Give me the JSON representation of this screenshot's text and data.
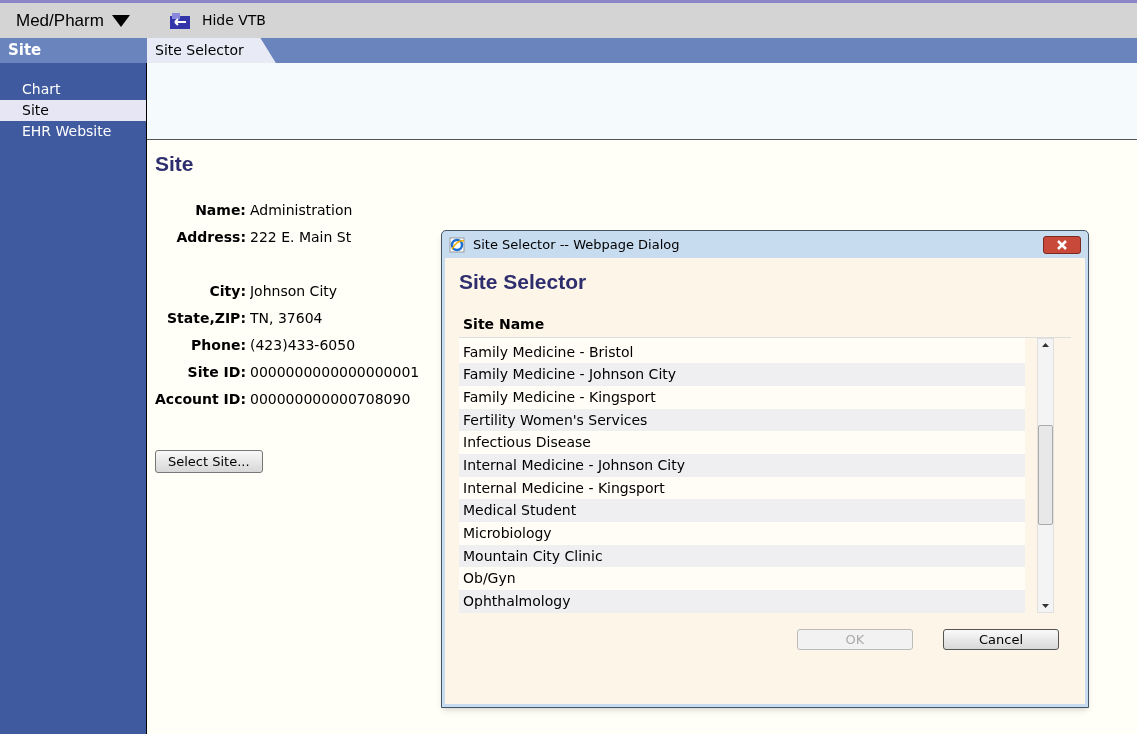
{
  "toolbar": {
    "menu": "Med/Pharm",
    "hide_button": "Hide VTB"
  },
  "sidebar": {
    "title": "Site",
    "items": [
      {
        "label": "Chart",
        "selected": false
      },
      {
        "label": "Site",
        "selected": true
      },
      {
        "label": "EHR Website",
        "selected": false
      }
    ]
  },
  "tabs": [
    {
      "label": "Site Selector",
      "selected": true
    }
  ],
  "site": {
    "heading": "Site",
    "field_groups": [
      [
        {
          "label": "Name:",
          "value": "Administration"
        },
        {
          "label": "Address:",
          "value": "222 E. Main St"
        }
      ],
      [
        {
          "label": "City:",
          "value": "Johnson City"
        },
        {
          "label": "State,ZIP:",
          "value": "TN, 37604"
        },
        {
          "label": "Phone:",
          "value": "(423)433-6050"
        },
        {
          "label": "Site ID:",
          "value": "0000000000000000001"
        },
        {
          "label": "Account ID:",
          "value": "000000000000708090"
        }
      ]
    ],
    "button": "Select Site..."
  },
  "dialog": {
    "title": "Site Selector -- Webpage Dialog",
    "heading": "Site Selector",
    "column": "Site Name",
    "rows": [
      "Family Medicine - Bristol",
      "Family Medicine - Johnson City",
      "Family Medicine - Kingsport",
      "Fertility Women's Services",
      "Infectious Disease",
      "Internal Medicine - Johnson City",
      "Internal Medicine - Kingsport",
      "Medical Student",
      "Microbiology",
      "Mountain City Clinic",
      "Ob/Gyn",
      "Ophthalmology"
    ],
    "buttons": [
      {
        "label": "OK",
        "disabled": true
      },
      {
        "label": "Cancel",
        "disabled": false
      }
    ]
  }
}
